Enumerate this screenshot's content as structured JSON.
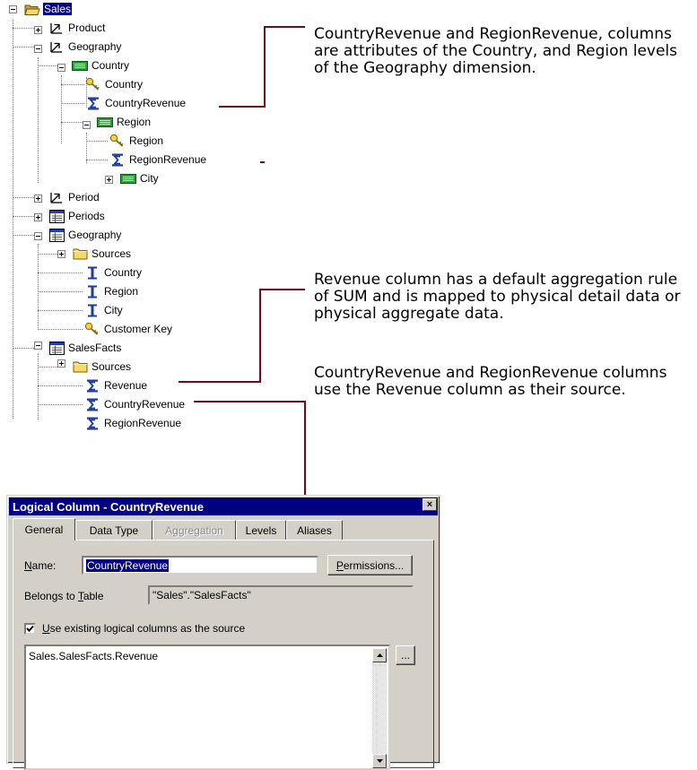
{
  "tree": {
    "rows": [
      {
        "label": "Sales",
        "icon": "folder-open-icon"
      },
      {
        "label": "Product",
        "icon": "dimension-icon"
      },
      {
        "label": "Geography",
        "icon": "dimension-icon"
      },
      {
        "label": "Country",
        "icon": "level-icon"
      },
      {
        "label": "Country",
        "icon": "key-icon"
      },
      {
        "label": "CountryRevenue",
        "icon": "sigma-column-icon"
      },
      {
        "label": "Region",
        "icon": "level-icon"
      },
      {
        "label": "Region",
        "icon": "key-icon"
      },
      {
        "label": "RegionRevenue",
        "icon": "sigma-column-icon"
      },
      {
        "label": "City",
        "icon": "level-icon"
      },
      {
        "label": "Period",
        "icon": "dimension-icon"
      },
      {
        "label": "Periods",
        "icon": "table-icon"
      },
      {
        "label": "Geography",
        "icon": "table-icon"
      },
      {
        "label": "Sources",
        "icon": "folder-icon"
      },
      {
        "label": "Country",
        "icon": "column-icon"
      },
      {
        "label": "Region",
        "icon": "column-icon"
      },
      {
        "label": "City",
        "icon": "column-icon"
      },
      {
        "label": "Customer Key",
        "icon": "key-icon"
      },
      {
        "label": "SalesFacts",
        "icon": "table-icon"
      },
      {
        "label": "Sources",
        "icon": "folder-icon"
      },
      {
        "label": "Revenue",
        "icon": "sigma-column-icon"
      },
      {
        "label": "CountryRevenue",
        "icon": "sigma-column-icon"
      },
      {
        "label": "RegionRevenue",
        "icon": "sigma-column-icon"
      }
    ]
  },
  "callouts": {
    "c1": "CountryRevenue and RegionRevenue, columns are attributes of the Country, and Region levels of the Geography dimension.",
    "c2": "Revenue column has a default aggregation rule of SUM and is mapped to physical detail data or physical aggregate data.",
    "c3": "CountryRevenue and RegionRevenue columns use the Revenue column as their source."
  },
  "colors": {
    "connector": "#6b0d1c",
    "selection": "#000080",
    "dialog_face": "#d4d0c8"
  },
  "dialog": {
    "title": "Logical Column - CountryRevenue",
    "close_glyph": "×",
    "tabs": [
      {
        "label": "General",
        "state": "active"
      },
      {
        "label": "Data Type",
        "state": "normal"
      },
      {
        "label": "Aggregation",
        "state": "disabled"
      },
      {
        "label": "Levels",
        "state": "normal"
      },
      {
        "label": "Aliases",
        "state": "normal"
      }
    ],
    "name_label_first": "N",
    "name_label_rest": "ame:",
    "name_value": "CountryRevenue",
    "permissions_first": "P",
    "permissions_rest": "ermissions...",
    "belongs_label_a": "Belongs to ",
    "belongs_label_b": "T",
    "belongs_label_c": "able",
    "belongs_value": "\"Sales\".\"SalesFacts\"",
    "use_existing_checked": true,
    "use_existing_first": "U",
    "use_existing_rest": "se existing logical columns as the source",
    "source_text": "Sales.SalesFacts.Revenue",
    "ellipsis_button": "..."
  }
}
